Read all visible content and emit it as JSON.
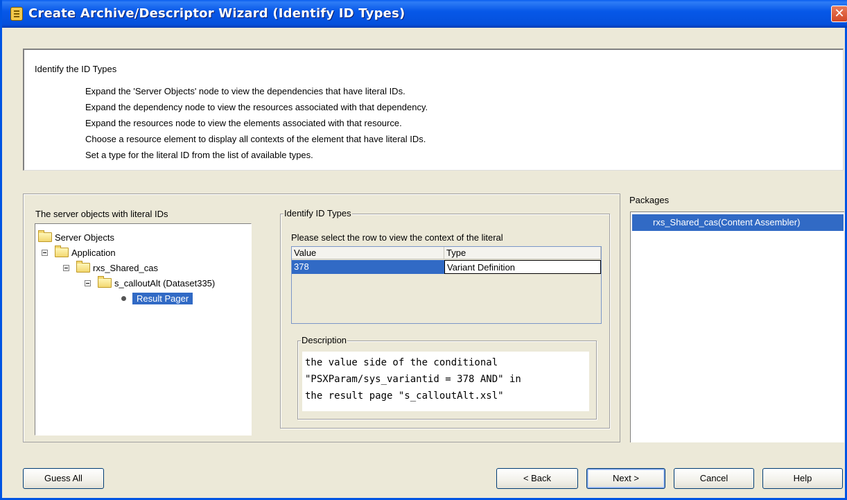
{
  "window": {
    "title": "Create Archive/Descriptor Wizard (Identify ID Types)",
    "close_glyph": "✕"
  },
  "instructions": {
    "heading": "Identify the ID Types",
    "lines": [
      "Expand the 'Server Objects' node to view the dependencies that have literal IDs.",
      "Expand the dependency node to view the resources associated with that dependency.",
      "Expand the resources node to view the elements associated with that resource.",
      "Choose a resource element to display all contexts of the element that have literal IDs.",
      "Set a type for the literal ID from the list of available types."
    ]
  },
  "tree": {
    "label": "The server objects with literal IDs",
    "root": "Server Objects",
    "application": "Application",
    "resource": "rxs_Shared_cas",
    "dataset": "s_calloutAlt (Dataset335)",
    "leaf": "Result Pager"
  },
  "id_types": {
    "group_label": "Identify ID Types",
    "hint": "Please select the row to view the context of the literal",
    "columns": {
      "value": "Value",
      "type": "Type"
    },
    "rows": [
      {
        "value": "378",
        "type": "Variant Definition"
      }
    ]
  },
  "description": {
    "label": "Description",
    "lines": [
      "the value side of the conditional",
      "\"PSXParam/sys_variantid = 378 AND\" in",
      "the result page \"s_calloutAlt.xsl\""
    ]
  },
  "packages": {
    "label": "Packages",
    "items": [
      "rxs_Shared_cas(Content Assembler)"
    ]
  },
  "buttons": {
    "guess_all": "Guess All",
    "back": "< Back",
    "next": "Next >",
    "cancel": "Cancel",
    "help": "Help"
  }
}
